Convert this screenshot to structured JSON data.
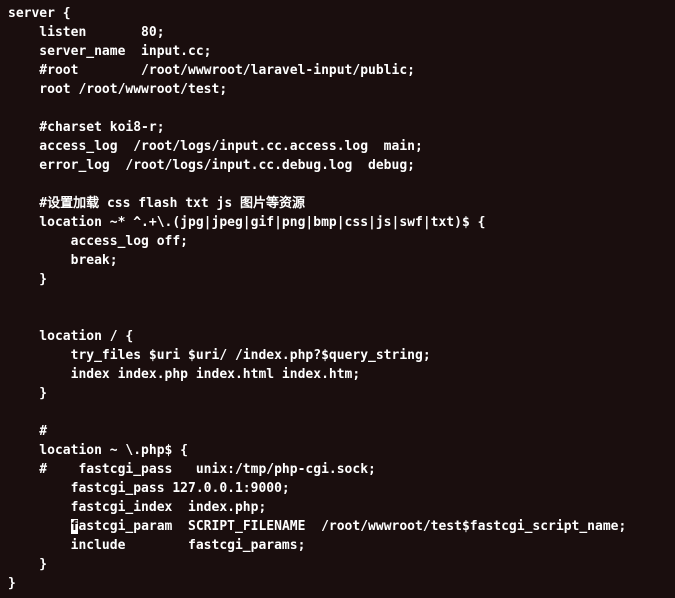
{
  "lines": [
    "server {",
    "    listen       80;",
    "    server_name  input.cc;",
    "    #root        /root/wwwroot/laravel-input/public;",
    "    root /root/wwwroot/test;",
    "",
    "    #charset koi8-r;",
    "    access_log  /root/logs/input.cc.access.log  main;",
    "    error_log  /root/logs/input.cc.debug.log  debug;",
    "",
    "    #设置加载 css flash txt js 图片等资源",
    "    location ~* ^.+\\.(jpg|jpeg|gif|png|bmp|css|js|swf|txt)$ {",
    "        access_log off;",
    "        break;",
    "    }",
    "",
    "",
    "    location / {",
    "        try_files $uri $uri/ /index.php?$query_string;",
    "        index index.php index.html index.htm;",
    "    }",
    "",
    "    #",
    "    location ~ \\.php$ {",
    "    #    fastcgi_pass   unix:/tmp/php-cgi.sock;",
    "        fastcgi_pass 127.0.0.1:9000;",
    "        fastcgi_index  index.php;"
  ],
  "cursor_line": {
    "pre": "        ",
    "hl": "f",
    "post": "astcgi_param  SCRIPT_FILENAME  /root/wwwroot/test$fastcgi_script_name;"
  },
  "lines_after": [
    "        include        fastcgi_params;",
    "    }",
    "}"
  ]
}
